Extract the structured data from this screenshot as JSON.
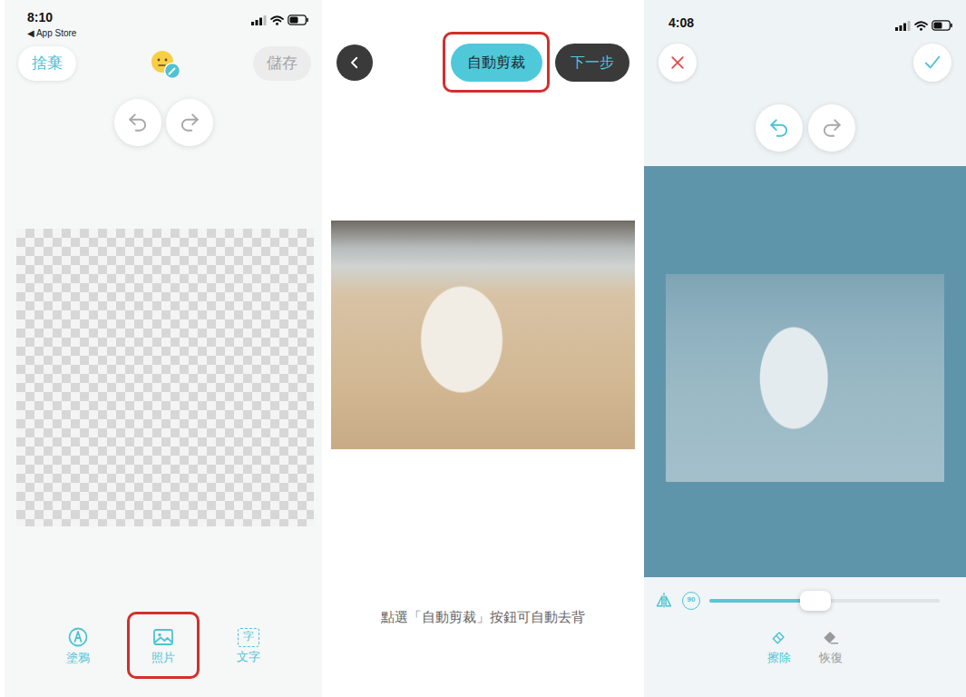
{
  "editor": {
    "status_bar": {
      "time": "8:10",
      "back_app": "◀ App Store"
    },
    "discard_button": "捨棄",
    "save_button": {
      "label": "儲存",
      "disabled": true
    },
    "undo": {
      "enabled": false
    },
    "redo": {
      "enabled": false
    },
    "tools": [
      {
        "label": "塗鴉",
        "kind": "draw",
        "highlighted": false,
        "icon_text": ""
      },
      {
        "label": "照片",
        "kind": "photo",
        "highlighted": true,
        "icon_text": ""
      },
      {
        "label": "文字",
        "kind": "text",
        "highlighted": false,
        "icon_text": "字"
      }
    ]
  },
  "cropper": {
    "auto_crop_button": {
      "label": "自動剪裁",
      "highlighted": true
    },
    "next_button": "下一步",
    "hint": "點選「自動剪裁」按鈕可自動去背"
  },
  "eraser": {
    "status_bar": {
      "time": "4:08"
    },
    "undo": {
      "enabled": true
    },
    "redo": {
      "enabled": false
    },
    "rotate_label": "90",
    "size_slider": {
      "level": 0.46
    },
    "tools": [
      {
        "label": "擦除",
        "kind": "erase",
        "selected": true
      },
      {
        "label": "恢復",
        "kind": "restore",
        "selected": false
      }
    ]
  }
}
